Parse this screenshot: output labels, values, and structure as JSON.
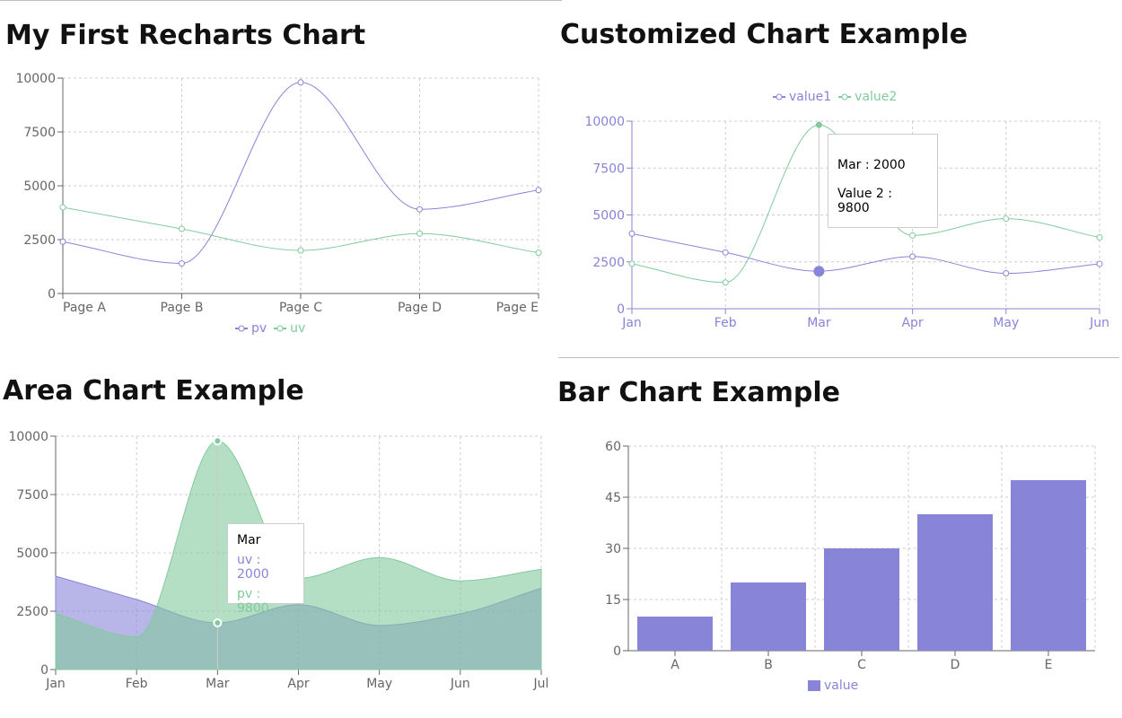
{
  "titles": {
    "chart1": "My First Recharts Chart",
    "chart2": "Customized Chart Example",
    "chart3": "Area Chart Example",
    "chart4": "Bar Chart Example"
  },
  "chart_data": [
    {
      "type": "line",
      "title": "My First Recharts Chart",
      "categories": [
        "Page A",
        "Page B",
        "Page C",
        "Page D",
        "Page E"
      ],
      "series": [
        {
          "name": "pv",
          "color": "#8884d8",
          "values": [
            2400,
            1398,
            9800,
            3908,
            4800
          ]
        },
        {
          "name": "uv",
          "color": "#82ca9d",
          "values": [
            4000,
            3000,
            2000,
            2780,
            1890
          ]
        }
      ],
      "yticks": [
        "0",
        "2500",
        "5000",
        "7500",
        "10000"
      ],
      "ylim": [
        0,
        10000
      ],
      "grid": true,
      "legend": "bottom"
    },
    {
      "type": "line",
      "title": "Customized Chart Example",
      "categories": [
        "Jan",
        "Feb",
        "Mar",
        "Apr",
        "May",
        "Jun"
      ],
      "series": [
        {
          "name": "value1",
          "color": "#8884d8",
          "values": [
            4000,
            3000,
            2000,
            2780,
            1890,
            2390
          ]
        },
        {
          "name": "value2",
          "color": "#82ca9d",
          "values": [
            2400,
            1398,
            9800,
            3908,
            4800,
            3800
          ]
        }
      ],
      "yticks": [
        "0",
        "2500",
        "5000",
        "7500",
        "10000"
      ],
      "ylim": [
        0,
        10000
      ],
      "grid": true,
      "legend": "top",
      "tooltip": {
        "line1": "Mar : 2000",
        "line2": "Value 2 : 9800"
      }
    },
    {
      "type": "area",
      "title": "Area Chart Example",
      "categories": [
        "Jan",
        "Feb",
        "Mar",
        "Apr",
        "May",
        "Jun",
        "Jul"
      ],
      "series": [
        {
          "name": "uv",
          "color": "#8884d8",
          "values": [
            4000,
            3000,
            2000,
            2780,
            1890,
            2390,
            3490
          ]
        },
        {
          "name": "pv",
          "color": "#82ca9d",
          "values": [
            2400,
            1398,
            9800,
            3908,
            4800,
            3800,
            4300
          ]
        }
      ],
      "yticks": [
        "0",
        "2500",
        "5000",
        "7500",
        "10000"
      ],
      "ylim": [
        0,
        10000
      ],
      "grid": true,
      "tooltip": {
        "label": "Mar",
        "line1": "uv : 2000",
        "line2": "pv : 9800"
      }
    },
    {
      "type": "bar",
      "title": "Bar Chart Example",
      "categories": [
        "A",
        "B",
        "C",
        "D",
        "E"
      ],
      "series": [
        {
          "name": "value",
          "color": "#8884d8",
          "values": [
            10,
            20,
            30,
            40,
            50
          ]
        }
      ],
      "yticks": [
        "0",
        "15",
        "30",
        "45",
        "60"
      ],
      "ylim": [
        0,
        60
      ],
      "grid": true,
      "legend": "bottom"
    }
  ]
}
